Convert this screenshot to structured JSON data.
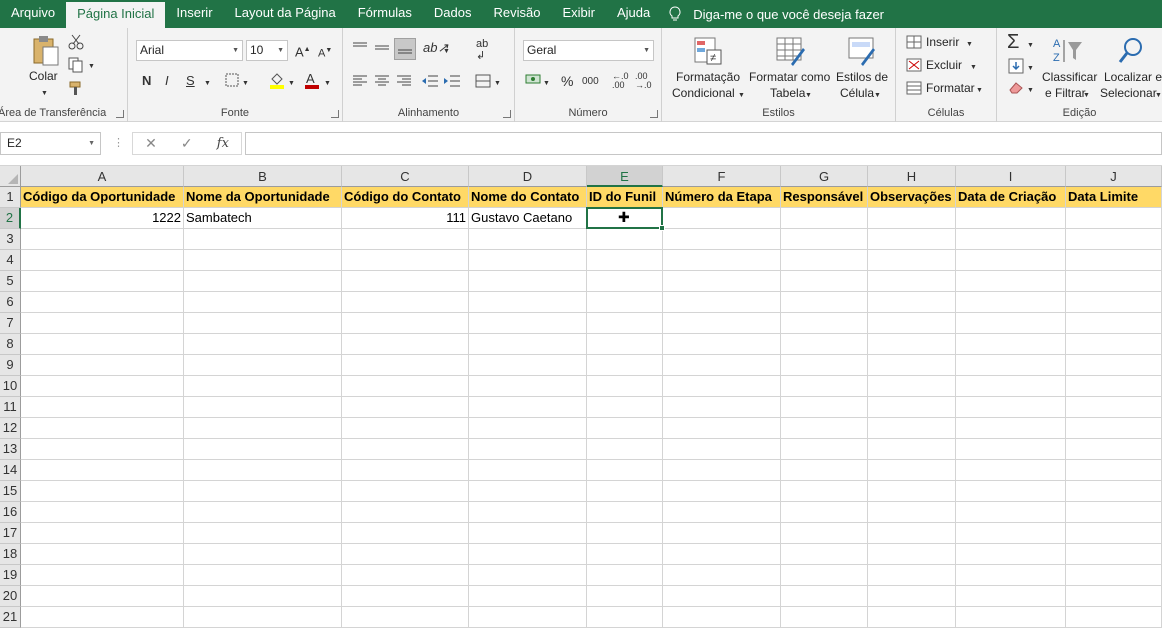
{
  "menu": {
    "tabs": [
      "Arquivo",
      "Página Inicial",
      "Inserir",
      "Layout da Página",
      "Fórmulas",
      "Dados",
      "Revisão",
      "Exibir",
      "Ajuda"
    ],
    "active_tab": "Página Inicial",
    "tell_me": "Diga-me o que você deseja fazer"
  },
  "ribbon": {
    "clipboard": {
      "label": "Área de Transferência",
      "paste": "Colar"
    },
    "font": {
      "label": "Fonte",
      "name": "Arial",
      "size": "10",
      "bold": "N",
      "italic": "I",
      "underline": "S"
    },
    "alignment": {
      "label": "Alinhamento"
    },
    "number": {
      "label": "Número",
      "format": "Geral",
      "percent": "%",
      "thousands": "000"
    },
    "styles": {
      "label": "Estilos",
      "conditional_line1": "Formatação",
      "conditional_line2": "Condicional",
      "table_line1": "Formatar como",
      "table_line2": "Tabela",
      "cell_line1": "Estilos de",
      "cell_line2": "Célula"
    },
    "cells": {
      "label": "Células",
      "insert": "Inserir",
      "delete": "Excluir",
      "format": "Formatar"
    },
    "editing": {
      "label": "Edição",
      "sort_line1": "Classificar",
      "sort_line2": "e Filtrar",
      "find_line1": "Localizar e",
      "find_line2": "Selecionar"
    }
  },
  "formula_bar": {
    "name_box": "E2",
    "fx": "fx",
    "value": ""
  },
  "sheet": {
    "columns": [
      "A",
      "B",
      "C",
      "D",
      "E",
      "F",
      "G",
      "H",
      "I",
      "J"
    ],
    "rows": [
      "1",
      "2",
      "3",
      "4",
      "5",
      "6",
      "7",
      "8",
      "9",
      "10",
      "11",
      "12",
      "13",
      "14",
      "15",
      "16",
      "17",
      "18",
      "19",
      "20",
      "21"
    ],
    "selected_cell": "E2",
    "header_fill": "#ffd966",
    "accent": "#217346",
    "data": [
      [
        "Código da Oportunidade",
        "Nome da Oportunidade",
        "Código do Contato",
        "Nome do Contato",
        "ID do Funil",
        "Número da Etapa",
        "Responsável",
        "Observações",
        "Data de Criação",
        "Data Limite"
      ],
      [
        "1222",
        "Sambatech",
        "111",
        "Gustavo Caetano",
        "",
        "",
        "",
        "",
        "",
        ""
      ]
    ]
  }
}
